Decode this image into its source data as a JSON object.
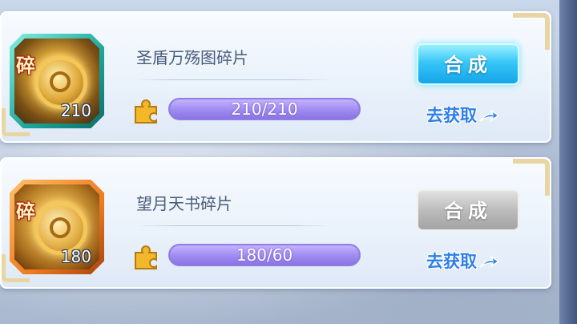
{
  "items": [
    {
      "badge": "碎",
      "count": "210",
      "name": "圣盾万殇图碎片",
      "progress_text": "210/210",
      "progress_fraction": 1.0,
      "compose_label": "合成",
      "compose_state": "active",
      "get_label": "去获取",
      "icon": "golden-shield-map-icon",
      "frame_color": "#1aa39a"
    },
    {
      "badge": "碎",
      "count": "180",
      "name": "望月天书碎片",
      "progress_text": "180/60",
      "progress_fraction": 1.0,
      "compose_label": "合成",
      "compose_state": "disabled",
      "get_label": "去获取",
      "icon": "moon-scroll-book-icon",
      "frame_color": "#f07a1f"
    }
  ],
  "colors": {
    "progress_fill": "#a18ef2",
    "compose_active": "#37c6f7",
    "compose_disabled": "#bcbcbc",
    "get_link": "#2f7fe8"
  }
}
